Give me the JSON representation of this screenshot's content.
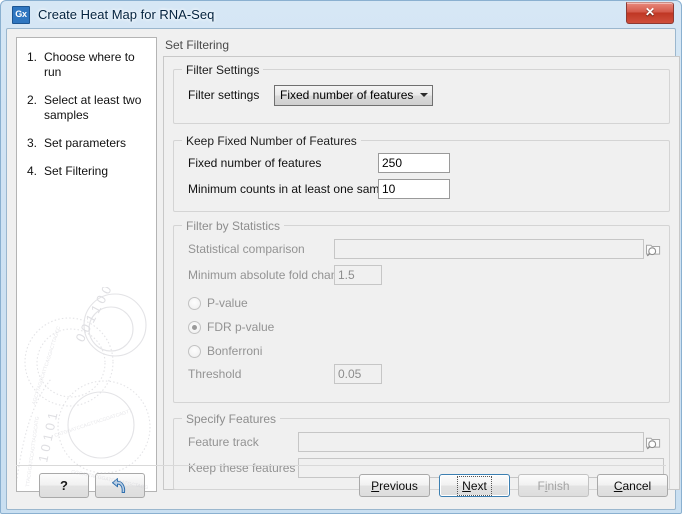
{
  "window": {
    "title": "Create Heat Map for RNA-Seq",
    "app_icon": "Gx",
    "close_label": "✕"
  },
  "sidebar": {
    "steps": [
      {
        "num": "1.",
        "label": "Choose where to run"
      },
      {
        "num": "2.",
        "label": "Select at least two samples"
      },
      {
        "num": "3.",
        "label": "Set parameters"
      },
      {
        "num": "4.",
        "label": "Set Filtering"
      }
    ]
  },
  "panel": {
    "title": "Set Filtering",
    "filter_settings": {
      "legend": "Filter Settings",
      "filter_settings_label": "Filter settings",
      "filter_settings_value": "Fixed number of features"
    },
    "keep_fixed": {
      "legend": "Keep Fixed Number of Features",
      "fixed_number_label": "Fixed number of features",
      "fixed_number_value": "250",
      "min_counts_label": "Minimum counts in at least one sample",
      "min_counts_value": "10"
    },
    "filter_stats": {
      "legend": "Filter by Statistics",
      "statistical_comparison_label": "Statistical comparison",
      "statistical_comparison_value": "",
      "fold_change_label": "Minimum absolute fold change",
      "fold_change_value": "1.5",
      "radios": [
        {
          "label": "P-value",
          "checked": false
        },
        {
          "label": "FDR p-value",
          "checked": true
        },
        {
          "label": "Bonferroni",
          "checked": false
        }
      ],
      "threshold_label": "Threshold",
      "threshold_value": "0.05"
    },
    "specify_features": {
      "legend": "Specify Features",
      "feature_track_label": "Feature track",
      "feature_track_value": "",
      "keep_features_label": "Keep these features",
      "keep_features_value": ""
    }
  },
  "buttons": {
    "help": "?",
    "reset_icon": "reset-arrow-icon",
    "previous": "Previous",
    "next": "Next",
    "finish": "Finish",
    "cancel": "Cancel"
  },
  "colors": {
    "accent": "#3c7fb1",
    "title_bar": "#cfe2f3",
    "close_button": "#bf3724",
    "app_icon": "#2f76c0"
  }
}
